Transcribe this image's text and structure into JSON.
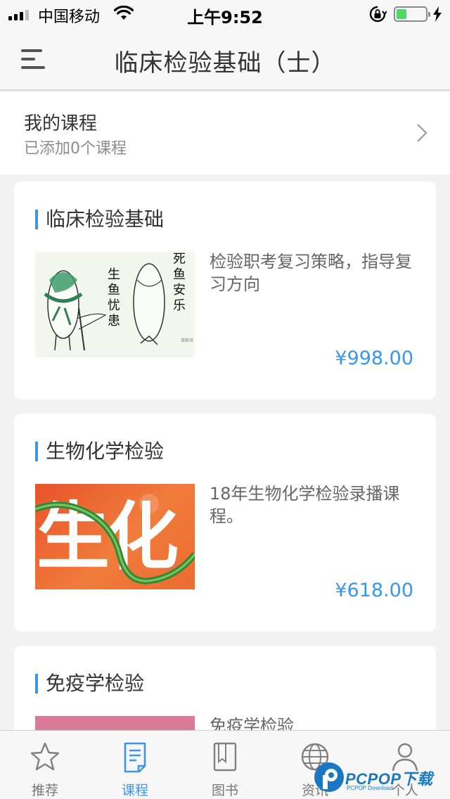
{
  "status_bar": {
    "carrier": "中国移动",
    "time": "上午9:52",
    "battery_level": 0.35,
    "colors": {
      "battery": "#4cd964"
    }
  },
  "header": {
    "title": "临床检验基础（士）",
    "menu_icon": "hamburger-menu-icon"
  },
  "my_course": {
    "title": "我的课程",
    "subtitle": "已添加0个课程",
    "icon": "chevron-right-icon"
  },
  "courses": [
    {
      "title": "临床检验基础",
      "description": "检验职考复习策略，指导复习方向",
      "price": "¥998.00",
      "thumbnail": {
        "kind": "ink-fish-illustration",
        "captions": [
          "生鱼忧患",
          "死鱼安乐"
        ],
        "caption_lines": [
          "生",
          "鱼",
          "忧",
          "患"
        ],
        "caption_lines_2": [
          "死",
          "鱼",
          "安",
          "乐"
        ]
      }
    },
    {
      "title": "生物化学检验",
      "description": "18年生物化学检验录播课程。",
      "price": "¥618.00",
      "thumbnail": {
        "kind": "orange-banner",
        "text": "生化"
      }
    },
    {
      "title": "免疫学检验",
      "description": "免疫学检验",
      "price": "",
      "thumbnail": {
        "kind": "pink-banner"
      }
    }
  ],
  "tabs": [
    {
      "label": "推荐",
      "icon": "star-icon",
      "active": false
    },
    {
      "label": "课程",
      "icon": "course-document-icon",
      "active": true
    },
    {
      "label": "图书",
      "icon": "book-icon",
      "active": false
    },
    {
      "label": "资讯",
      "icon": "globe-icon",
      "active": false
    },
    {
      "label": "个人",
      "icon": "person-icon",
      "active": false
    }
  ],
  "watermark": {
    "brand": "PCPOP下载",
    "sub": "PCPOP Download"
  },
  "colors": {
    "accent": "#3a96e8",
    "background": "#f2f2f2",
    "card": "#ffffff"
  }
}
